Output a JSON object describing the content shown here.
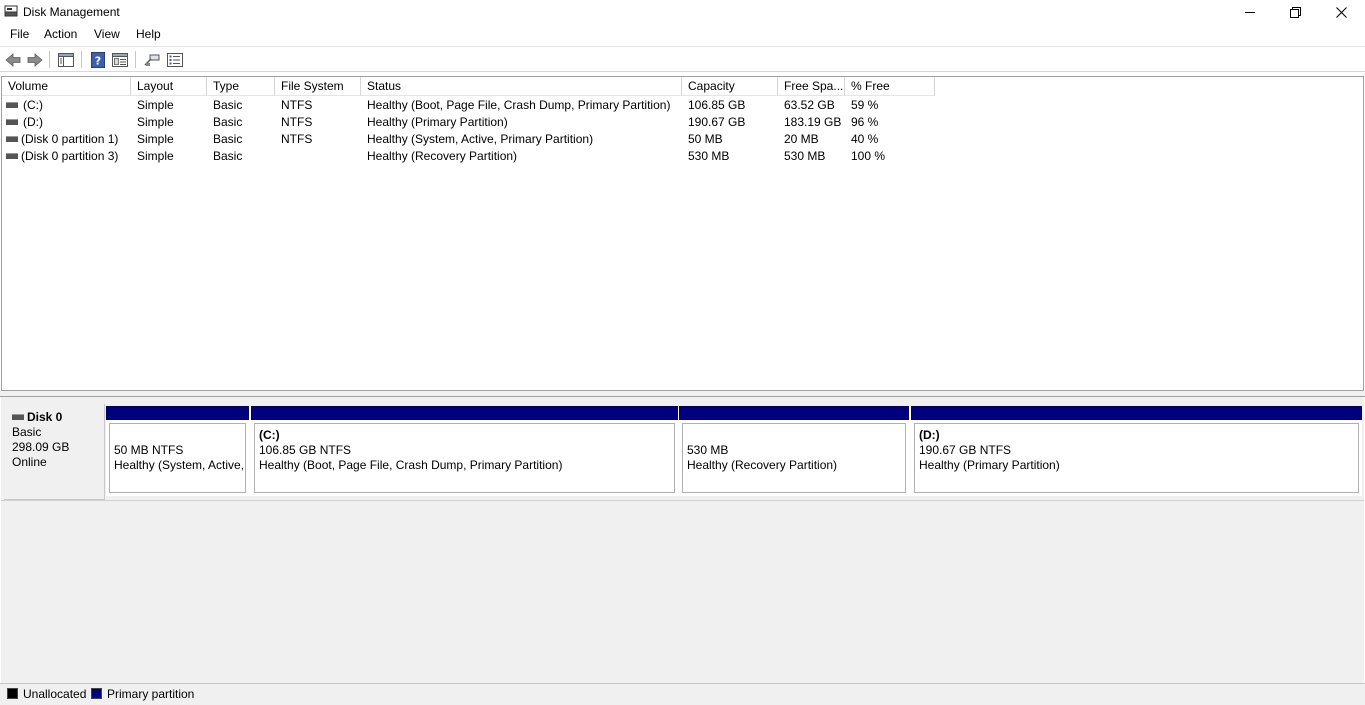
{
  "window": {
    "title": "Disk Management"
  },
  "menu": {
    "items": [
      "File",
      "Action",
      "View",
      "Help"
    ]
  },
  "toolbar": {
    "buttons": [
      "back-arrow-icon",
      "forward-arrow-icon",
      "console-tree-icon",
      "help-icon",
      "properties-icon",
      "rescan-icon",
      "list-view-icon"
    ]
  },
  "volume_list": {
    "columns": [
      "Volume",
      "Layout",
      "Type",
      "File System",
      "Status",
      "Capacity",
      "Free Spa...",
      "% Free"
    ],
    "rows": [
      {
        "volume": "(C:)",
        "layout": "Simple",
        "type": "Basic",
        "fs": "NTFS",
        "status": "Healthy (Boot, Page File, Crash Dump, Primary Partition)",
        "capacity": "106.85 GB",
        "free": "63.52 GB",
        "pct": "59 %"
      },
      {
        "volume": "(D:)",
        "layout": "Simple",
        "type": "Basic",
        "fs": "NTFS",
        "status": "Healthy (Primary Partition)",
        "capacity": "190.67 GB",
        "free": "183.19 GB",
        "pct": "96 %"
      },
      {
        "volume": "(Disk 0 partition 1)",
        "layout": "Simple",
        "type": "Basic",
        "fs": "NTFS",
        "status": "Healthy (System, Active, Primary Partition)",
        "capacity": "50 MB",
        "free": "20 MB",
        "pct": "40 %"
      },
      {
        "volume": "(Disk 0 partition 3)",
        "layout": "Simple",
        "type": "Basic",
        "fs": "",
        "status": "Healthy (Recovery Partition)",
        "capacity": "530 MB",
        "free": "530 MB",
        "pct": "100 %"
      }
    ]
  },
  "disk": {
    "name": "Disk 0",
    "kind": "Basic",
    "size": "298.09 GB",
    "state": "Online",
    "partitions": [
      {
        "name": "",
        "size": "50 MB NTFS",
        "status": "Healthy (System, Active, Primary Partition)"
      },
      {
        "name": "(C:)",
        "size": "106.85 GB NTFS",
        "status": "Healthy (Boot, Page File, Crash Dump, Primary Partition)"
      },
      {
        "name": "",
        "size": "530 MB",
        "status": "Healthy (Recovery Partition)"
      },
      {
        "name": "(D:)",
        "size": "190.67 GB NTFS",
        "status": "Healthy (Primary Partition)"
      }
    ]
  },
  "legend": {
    "unallocated": {
      "label": "Unallocated",
      "color": "#000000"
    },
    "primary": {
      "label": "Primary partition",
      "color": "#00007f"
    }
  }
}
